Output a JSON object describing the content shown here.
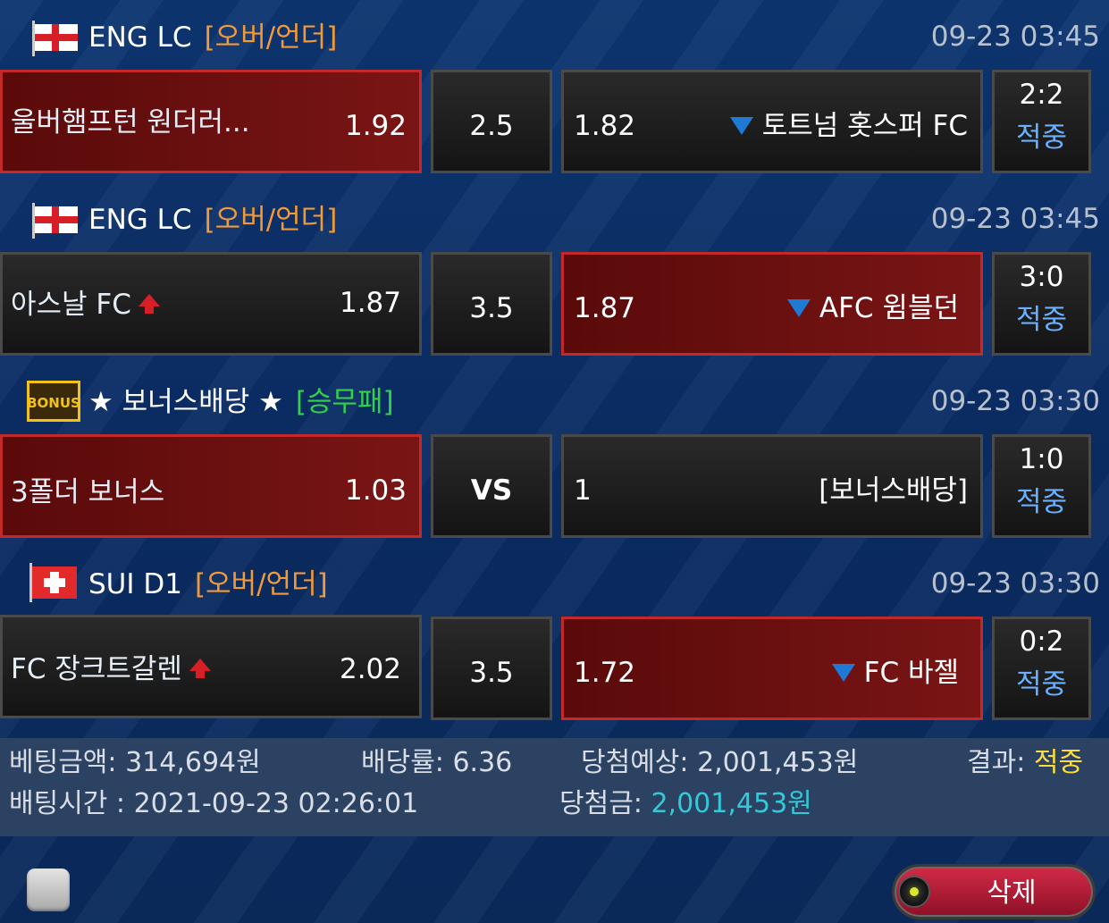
{
  "matches": [
    {
      "flag": "england-flag-icon",
      "league": "ENG LC",
      "type": "[오버/언더]",
      "time": "09-23 03:45",
      "home_team": "울버햄프턴 원더러...",
      "home_odds": "1.92",
      "handicap": "2.5",
      "away_odds": "1.82",
      "away_team": "토트넘 홋스퍼 FC",
      "score": "2:2",
      "status": "적중",
      "selected": "home",
      "home_arrow": "",
      "away_arrow": "down-arrow-icon"
    },
    {
      "flag": "england-flag-icon",
      "league": "ENG LC",
      "type": "[오버/언더]",
      "time": "09-23 03:45",
      "home_team": "아스날 FC",
      "home_odds": "1.87",
      "handicap": "3.5",
      "away_odds": "1.87",
      "away_team": "AFC 윔블던",
      "score": "3:0",
      "status": "적중",
      "selected": "away",
      "home_arrow": "up-arrow-icon",
      "away_arrow": "down-arrow-icon"
    },
    {
      "flag": "bonus-badge-icon",
      "league": "★ 보너스배당 ★",
      "type": "[승무패]",
      "time": "09-23 03:30",
      "home_team": "3폴더 보너스",
      "home_odds": "1.03",
      "handicap": "VS",
      "away_odds": "1",
      "away_team": "[보너스배당]",
      "score": "1:0",
      "status": "적중",
      "selected": "home",
      "home_arrow": "",
      "away_arrow": ""
    },
    {
      "flag": "switzerland-flag-icon",
      "league": "SUI D1",
      "type": "[오버/언더]",
      "time": "09-23 03:30",
      "home_team": "FC 장크트갈렌",
      "home_odds": "2.02",
      "handicap": "3.5",
      "away_odds": "1.72",
      "away_team": "FC 바젤",
      "score": "0:2",
      "status": "적중",
      "selected": "away",
      "home_arrow": "up-arrow-icon",
      "away_arrow": "down-arrow-icon"
    }
  ],
  "bonus_badge_text": "BONUS",
  "summary": {
    "bet_amount_label": "베팅금액:",
    "bet_amount": "314,694원",
    "rate_label": "배당률:",
    "rate": "6.36",
    "expected_label": "당첨예상:",
    "expected": "2,001,453원",
    "result_label": "결과:",
    "result": "적중",
    "bet_time_label": "배팅시간 :",
    "bet_time": "2021-09-23 02:26:01",
    "win_label": "당첨금:",
    "win_amount": "2,001,453원"
  },
  "footer": {
    "delete_label": "삭제"
  },
  "colors": {
    "background": "#0b2f66",
    "selected_box": "#7a1515",
    "selected_border": "#c22a2a",
    "orange_type": "#f29a3a",
    "green_type": "#33d14a",
    "status_blue": "#6ab0ff",
    "result_yellow": "#ffdc3a",
    "win_cyan": "#33c9d9",
    "delete_button": "#c8203d"
  }
}
